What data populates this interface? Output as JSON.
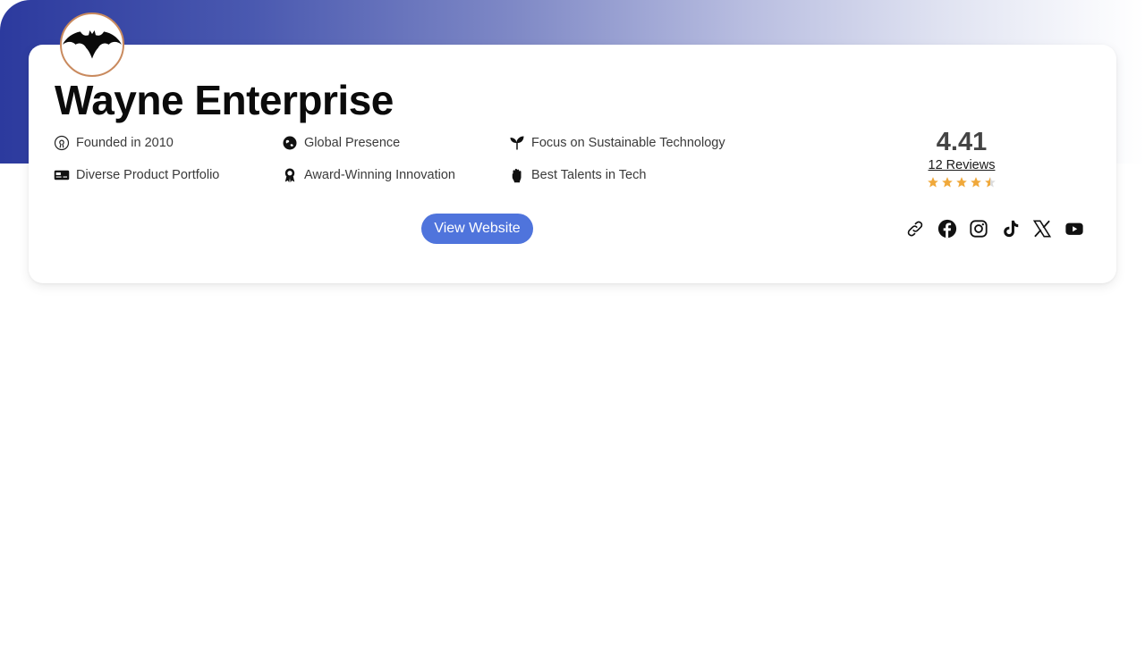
{
  "company": {
    "name": "Wayne Enterprise",
    "logo_icon": "bat-icon"
  },
  "features": [
    {
      "icon": "open-source-icon",
      "label": "Founded in 2010"
    },
    {
      "icon": "globe-icon",
      "label": "Global Presence"
    },
    {
      "icon": "sprout-icon",
      "label": "Focus on Sustainable Technology"
    },
    {
      "icon": "id-card-icon",
      "label": "Diverse Product Portfolio"
    },
    {
      "icon": "award-icon",
      "label": "Award-Winning Innovation"
    },
    {
      "icon": "fist-icon",
      "label": "Best Talents in Tech"
    }
  ],
  "rating": {
    "value": "4.41",
    "reviews_label": "12 Reviews",
    "stars_out_of": 5,
    "stars_value": 4.41,
    "star_color": "#f0a83a"
  },
  "actions": {
    "view_website_label": "View Website",
    "button_color": "#4f74dc"
  },
  "socials": [
    {
      "icon": "link-icon",
      "name": "Website link"
    },
    {
      "icon": "facebook-icon",
      "name": "Facebook"
    },
    {
      "icon": "instagram-icon",
      "name": "Instagram"
    },
    {
      "icon": "tiktok-icon",
      "name": "TikTok"
    },
    {
      "icon": "x-icon",
      "name": "X"
    },
    {
      "icon": "youtube-icon",
      "name": "YouTube"
    }
  ]
}
